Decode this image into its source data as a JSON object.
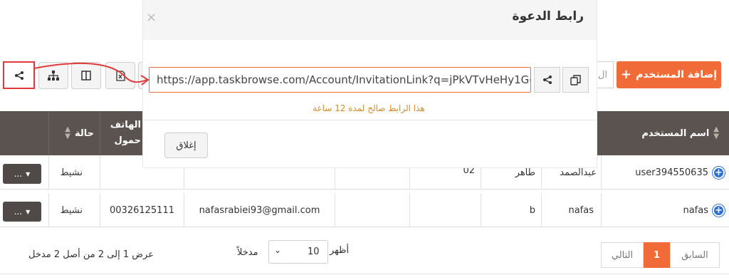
{
  "toolbar": {
    "add_user_label": "إضافة المستخدم",
    "search_partial": "ال"
  },
  "table": {
    "headers": {
      "username": "اسم المستخدم",
      "phone_line1": "الهاتف",
      "phone_line2": "حمول",
      "status": "حالة"
    },
    "rows": [
      {
        "username": "user394550635",
        "first_name": "عبدالصمد",
        "last_name": "طاهر",
        "extra": "02",
        "email": "",
        "phone": "",
        "status": "نشيط",
        "action": "..."
      },
      {
        "username": "nafas",
        "first_name": "nafas",
        "last_name": "b",
        "extra": "",
        "email": "nafasrabiei93@gmail.com",
        "phone": "00326125111",
        "status": "نشيط",
        "action": "..."
      }
    ]
  },
  "footer": {
    "info": "عرض 1 إلى 2 من أصل 2 مدخل",
    "show_label": "أظهر",
    "entries_label": "مدخلاً",
    "page_length": "10",
    "prev_label": "السابق",
    "current_page": "1",
    "next_label": "التالي"
  },
  "modal": {
    "title": "رابط الدعوة",
    "close_symbol": "×",
    "link_value": "https://app.taskbrowse.com/Account/InvitationLink?q=jPkVTvHeHy1G(",
    "validity_note": "هذا الرابط صالح لمدة 12 ساعة",
    "close_button": "إغلاق"
  },
  "colors": {
    "accent": "#f06b38",
    "header_bg": "#5a5350",
    "highlight": "#e03a3a",
    "info_plus": "#2e6fd1",
    "validity_text": "#d98a2a"
  },
  "icons": [
    "share-icon",
    "sitemap-icon",
    "columns-icon",
    "excel-icon",
    "copy-icon",
    "close-icon",
    "plus-icon",
    "sort-icon",
    "caret-down-icon"
  ]
}
